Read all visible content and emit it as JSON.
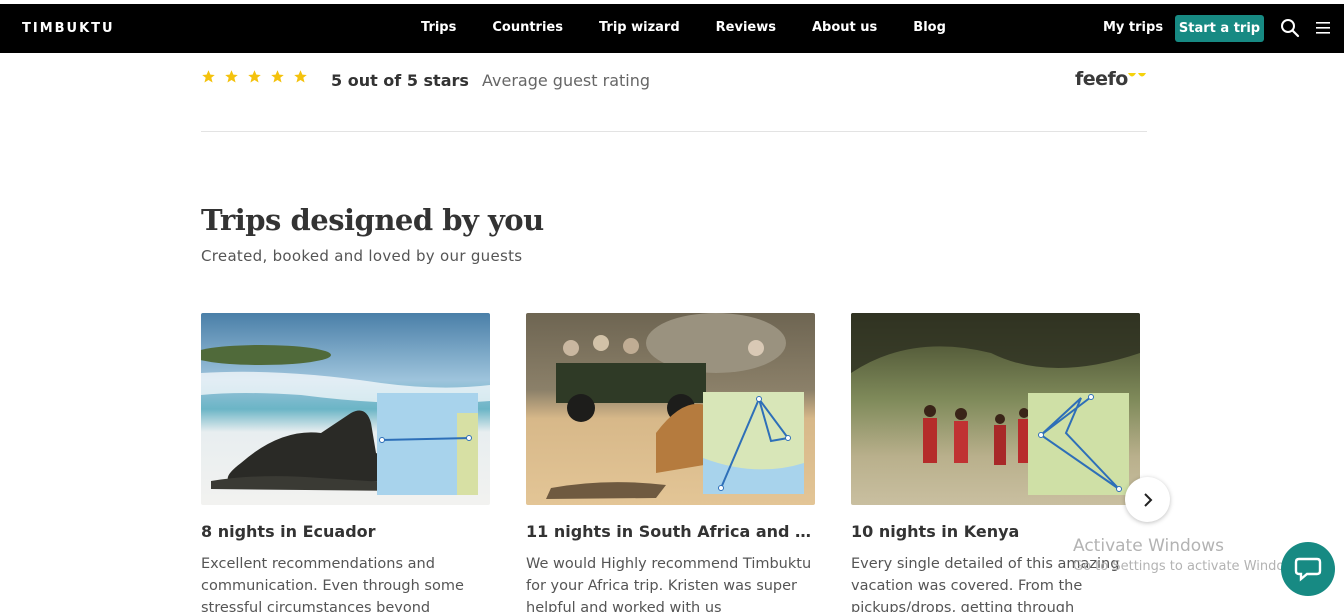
{
  "nav": {
    "brand": "TIMBUKTU",
    "links": [
      "Trips",
      "Countries",
      "Trip wizard",
      "Reviews",
      "About us",
      "Blog"
    ],
    "my_trips": "My trips",
    "start_trip": "Start a trip",
    "accent_color": "#178a83"
  },
  "rating": {
    "stars": 5,
    "summary": "5 out of 5 stars",
    "label": "Average guest rating",
    "provider": "feefo",
    "star_color": "#f4c20d"
  },
  "section": {
    "title": "Trips designed by you",
    "subtitle": "Created, booked and loved by our guests"
  },
  "cards": [
    {
      "title": "8 nights in Ecuador",
      "text": "Excellent recommendations and communication. Even through some stressful circumstances beyond"
    },
    {
      "title": "11 nights in South Africa and Za...",
      "text": "We would Highly recommend Timbuktu for your Africa trip. Kristen was super helpful and worked with us"
    },
    {
      "title": "10 nights in Kenya",
      "text": "Every single detailed of this amazing vacation was covered. From the pickups/drops, getting through"
    }
  ],
  "overlay": {
    "activate_title": "Activate Windows",
    "activate_sub": "Go to Settings to activate Windows."
  }
}
